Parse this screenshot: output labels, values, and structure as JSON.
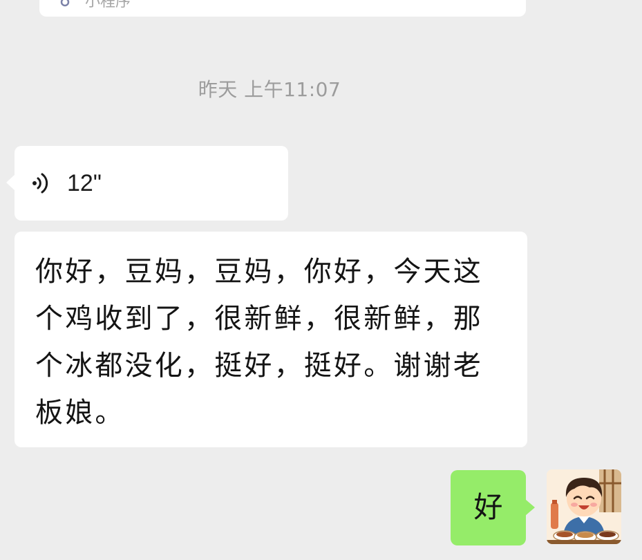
{
  "top_card": {
    "label": "小程序"
  },
  "timestamp": "昨天 上午11:07",
  "messages": {
    "voice": {
      "duration": "12\"",
      "transcript": "你好，豆妈，豆妈，你好，今天这个鸡收到了，很新鲜，很新鲜，那个冰都没化，挺好，挺好。谢谢老板娘。"
    },
    "reply": {
      "text": "好"
    }
  },
  "colors": {
    "background": "#ededed",
    "incoming_bubble": "#ffffff",
    "outgoing_bubble": "#95ec69",
    "timestamp_text": "#9c9c9c"
  },
  "icons": {
    "voice": "voice-wave-icon",
    "mini_program": "mini-program-icon"
  }
}
